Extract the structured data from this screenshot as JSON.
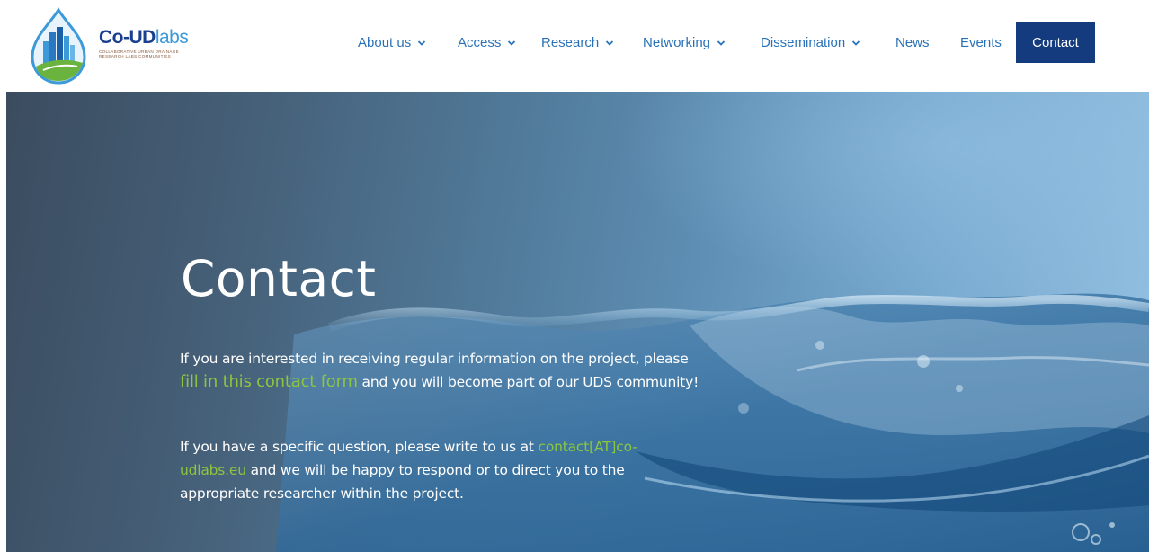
{
  "brand": {
    "title_prefix": "Co-UD",
    "title_suffix": "labs",
    "subtitle": "Collaborative Urban Drainage\nResearch Labs Communities",
    "colors": {
      "navy": "#1b3f8f",
      "light_blue": "#3c9ad8",
      "green": "#6bb33f"
    }
  },
  "nav": {
    "items": [
      {
        "label": "About us",
        "has_dropdown": true
      },
      {
        "label": "Access",
        "has_dropdown": true
      },
      {
        "label": "Research",
        "has_dropdown": true
      },
      {
        "label": "Networking",
        "has_dropdown": true
      },
      {
        "label": "Dissemination",
        "has_dropdown": true
      },
      {
        "label": "News",
        "has_dropdown": false
      },
      {
        "label": "Events",
        "has_dropdown": false
      },
      {
        "label": "Contact",
        "has_dropdown": false,
        "active": true
      }
    ],
    "colors": {
      "link": "#2a72b8",
      "active_bg": "#133b7d",
      "active_text": "#ffffff"
    }
  },
  "hero": {
    "title": "Contact",
    "p1_before": "If you are interested in receiving regular information on the project, please ",
    "p1_link": "fill in this contact form",
    "p1_after": " and you will become part of our UDS community!",
    "p2_before": "If you have a specific question, please write to us at ",
    "p2_link": "contact[AT]co-udlabs.eu",
    "p2_after": " and we will be happy to respond or to direct you to the appropriate researcher within the project.",
    "colors": {
      "text": "#ffffff",
      "link": "#8cc53f"
    },
    "background_image": "water-splash"
  },
  "icons": {
    "chevron": "chevron-down-icon",
    "logo": "drop-city-logo-icon"
  }
}
